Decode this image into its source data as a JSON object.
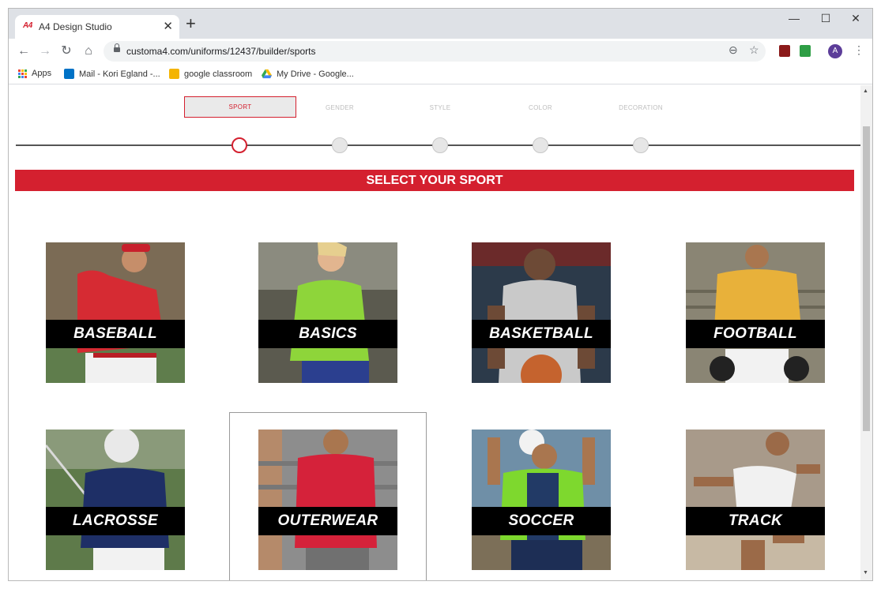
{
  "browser": {
    "tab_favicon": "A4",
    "tab_title": "A4 Design Studio",
    "tab_close": "✕",
    "new_tab": "+",
    "url": "customa4.com/uniforms/12437/builder/sports",
    "controls": {
      "minimize": "—",
      "maximize": "☐",
      "close": "✕"
    },
    "avatar_letter": "A"
  },
  "bookmarks": [
    {
      "label": "Apps",
      "icon": "apps-grid-icon"
    },
    {
      "label": "Mail - Kori Egland -...",
      "icon": "outlook-icon",
      "color": "#0072c6"
    },
    {
      "label": "google classroom",
      "icon": "classroom-icon",
      "color": "#f4b400"
    },
    {
      "label": "My Drive - Google...",
      "icon": "drive-icon"
    }
  ],
  "stepper": {
    "steps": [
      {
        "label": "SPORT",
        "active": true
      },
      {
        "label": "GENDER",
        "active": false
      },
      {
        "label": "STYLE",
        "active": false
      },
      {
        "label": "COLOR",
        "active": false
      },
      {
        "label": "DECORATION",
        "active": false
      }
    ]
  },
  "banner": {
    "title": "SELECT YOUR SPORT"
  },
  "sports": [
    {
      "label": "BASEBALL",
      "jersey_color": "#d62b33",
      "bg_color": "#7b6b55"
    },
    {
      "label": "BASICS",
      "jersey_color": "#8ed53a",
      "bg_color": "#5b5a4f"
    },
    {
      "label": "BASKETBALL",
      "jersey_color": "#c9c9c9",
      "bg_color": "#2c3a4a"
    },
    {
      "label": "FOOTBALL",
      "jersey_color": "#e8b13a",
      "bg_color": "#8a8574"
    },
    {
      "label": "LACROSSE",
      "jersey_color": "#1e2f66",
      "bg_color": "#5e7a4a"
    },
    {
      "label": "OUTERWEAR",
      "jersey_color": "#d5223a",
      "bg_color": "#8d8d8d"
    },
    {
      "label": "SOCCER",
      "jersey_color": "#7ed82e",
      "bg_color": "#6f8fa7"
    },
    {
      "label": "TRACK",
      "jersey_color": "#f1f1f1",
      "bg_color": "#a89a8a"
    }
  ],
  "colors": {
    "brand_red": "#d4202f"
  }
}
